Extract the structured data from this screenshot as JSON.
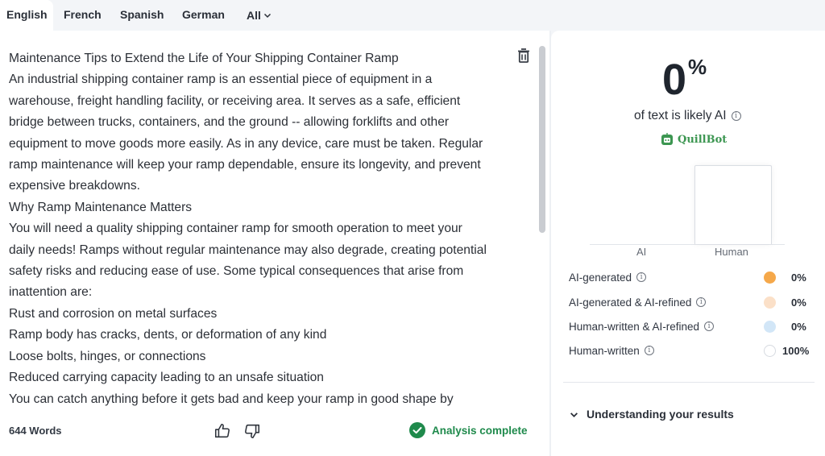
{
  "tabs": [
    {
      "label": "English",
      "active": true
    },
    {
      "label": "French"
    },
    {
      "label": "Spanish"
    },
    {
      "label": "German"
    },
    {
      "label": "All"
    }
  ],
  "document": {
    "lines": [
      "Maintenance Tips to Extend the Life of Your Shipping Container Ramp",
      "An industrial shipping container ramp is an essential piece of equipment in a",
      "warehouse, freight handling facility, or receiving area. It serves as a safe, efficient",
      "bridge between trucks, containers, and the ground -- allowing forklifts and other",
      "equipment to move goods more easily. As in any device, care must be taken. Regular",
      "ramp maintenance will keep your ramp dependable, ensure its longevity, and prevent",
      "expensive breakdowns.",
      "Why Ramp Maintenance Matters",
      "You will need a quality shipping container ramp for smooth operation to meet your",
      "daily needs! Ramps without regular maintenance may also degrade, creating potential",
      "safety risks and reducing ease of use. Some typical consequences that arise from",
      "inattention are:",
      "Rust and corrosion on metal surfaces",
      "Ramp body has cracks, dents, or deformation of any kind",
      "Loose bolts, hinges, or connections",
      "Reduced carrying capacity leading to an unsafe situation",
      "You can catch anything before it gets bad and keep your ramp in good shape by"
    ]
  },
  "footer": {
    "word_count": "644 Words",
    "status": "Analysis complete"
  },
  "result": {
    "percent": "0",
    "percent_sign": "%",
    "likely_text": "of text is likely AI",
    "brand": "QuillBot"
  },
  "chart_data": {
    "type": "bar",
    "categories": [
      "AI",
      "Human"
    ],
    "values": [
      0,
      100
    ],
    "ylim": [
      0,
      100
    ]
  },
  "breakdown": [
    {
      "label": "AI-generated",
      "value": "0%",
      "color": "#f5a84a"
    },
    {
      "label": "AI-generated & AI-refined",
      "value": "0%",
      "color": "#fbe0c8"
    },
    {
      "label": "Human-written & AI-refined",
      "value": "0%",
      "color": "#d2e6f7"
    },
    {
      "label": "Human-written",
      "value": "100%",
      "color": "#ffffff"
    }
  ],
  "understanding": {
    "label": "Understanding your results"
  },
  "colors": {
    "accent_green": "#1f8a4c",
    "brand_green": "#3c9651"
  },
  "icons": {
    "trash": "trash-icon",
    "thumbs_up": "thumbs-up-icon",
    "thumbs_down": "thumbs-down-icon",
    "check": "check-circle-icon",
    "info": "info-icon",
    "chevron": "chevron-down-icon"
  }
}
